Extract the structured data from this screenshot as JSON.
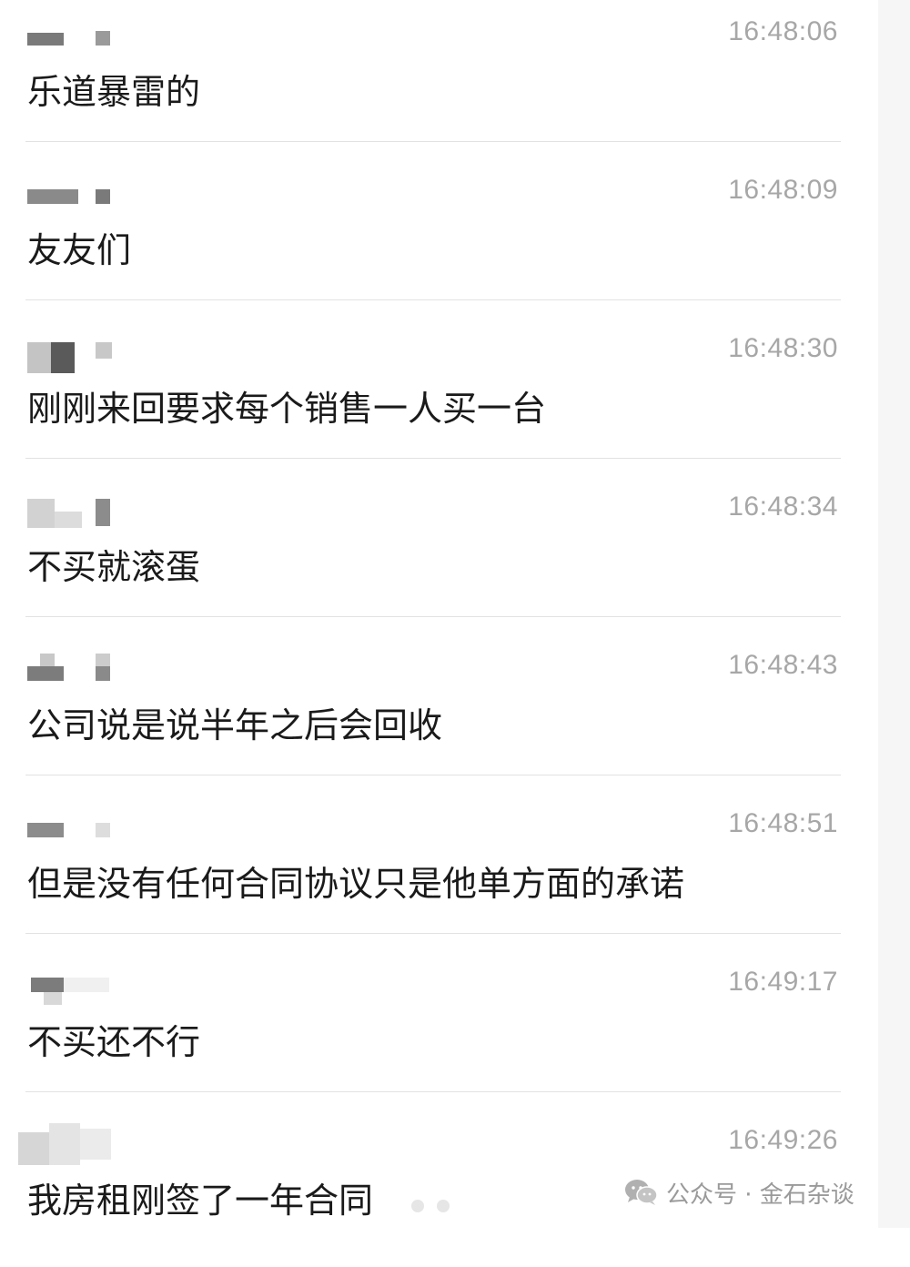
{
  "messages": [
    {
      "time": "16:48:06",
      "text": "乐道暴雷的"
    },
    {
      "time": "16:48:09",
      "text": "友友们"
    },
    {
      "time": "16:48:30",
      "text": "刚刚来回要求每个销售一人买一台"
    },
    {
      "time": "16:48:34",
      "text": "不买就滚蛋"
    },
    {
      "time": "16:48:43",
      "text": "公司说是说半年之后会回收"
    },
    {
      "time": "16:48:51",
      "text": "但是没有任何合同协议只是他单方面的承诺"
    },
    {
      "time": "16:49:17",
      "text": "不买还不行"
    },
    {
      "time": "16:49:26",
      "text": "我房租刚签了一年合同"
    }
  ],
  "watermark": {
    "icon": "wechat-icon",
    "text": "公众号 · 金石杂谈"
  },
  "colors": {
    "timestamp": "#a7a7a7",
    "message_text": "#1a1a1a",
    "divider": "#e2e2e2",
    "watermark": "#9a9a9a"
  }
}
